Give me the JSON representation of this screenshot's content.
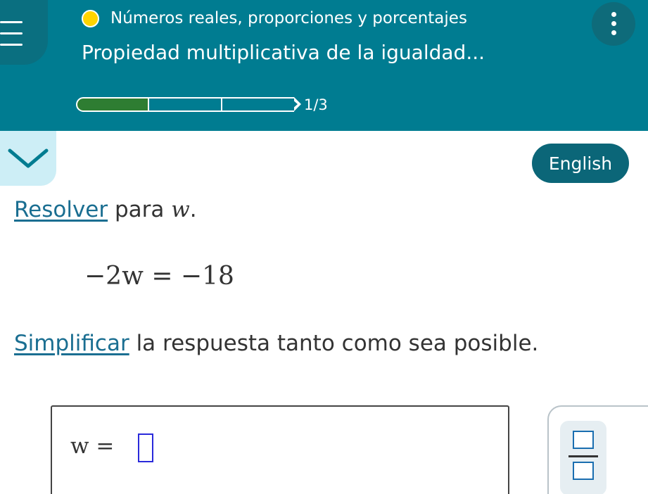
{
  "header": {
    "topic": "Números reales, proporciones y porcentajes",
    "lesson": "Propiedad multiplicativa de la igualdad...",
    "progress": {
      "current": 1,
      "total": 3,
      "label": "1/3"
    },
    "topic_dot_color": "#ffd400",
    "background_color": "#007c91"
  },
  "icons": {
    "menu": "hamburger-menu-icon",
    "more": "vertical-dots-icon",
    "collapse": "chevron-down-icon",
    "fraction": "fraction-icon"
  },
  "language_button": {
    "label": "English"
  },
  "problem": {
    "instruction_link": "Resolver",
    "instruction_rest": " para ",
    "instruction_var": "w",
    "instruction_end": ".",
    "equation": "−2w = −18",
    "simplify_link": "Simplificar",
    "simplify_rest": " la respuesta tanto como sea posible."
  },
  "answer": {
    "label": "w =",
    "value": ""
  }
}
